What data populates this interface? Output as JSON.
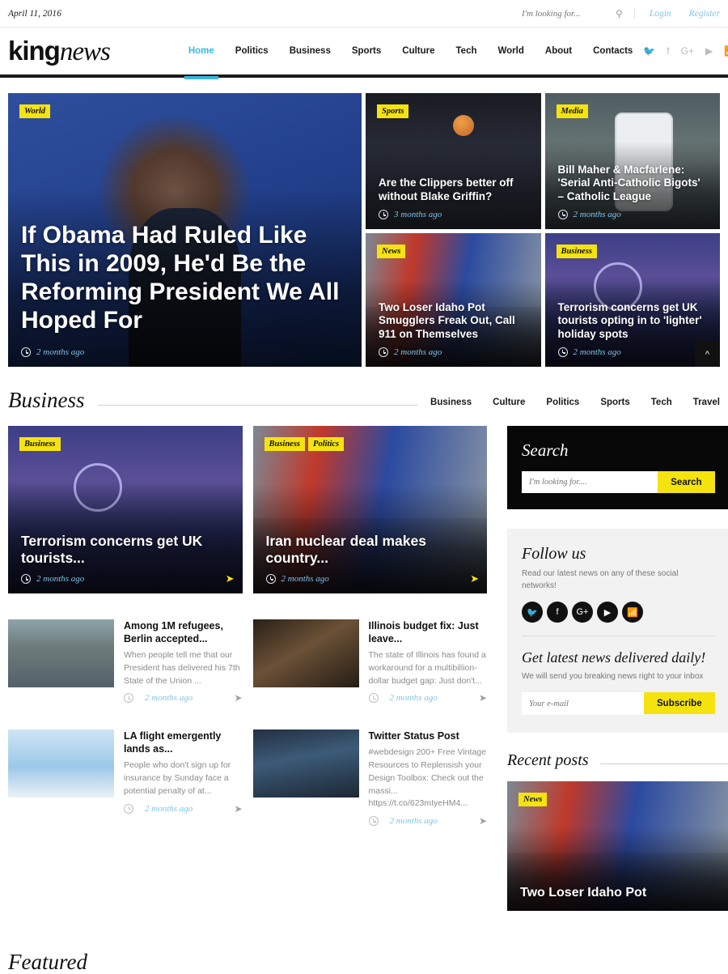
{
  "topbar": {
    "date": "April 11, 2016",
    "search_placeholder": "I'm looking for...",
    "search_value": "",
    "search_icon": "search-icon",
    "login": "Login",
    "register": "Register"
  },
  "header": {
    "logo_bold": "king",
    "logo_italic": "news",
    "nav": [
      {
        "label": "Home",
        "active": true
      },
      {
        "label": "Politics",
        "active": false
      },
      {
        "label": "Business",
        "active": false
      },
      {
        "label": "Sports",
        "active": false
      },
      {
        "label": "Culture",
        "active": false
      },
      {
        "label": "Tech",
        "active": false
      },
      {
        "label": "World",
        "active": false
      },
      {
        "label": "About",
        "active": false
      },
      {
        "label": "Contacts",
        "active": false
      }
    ],
    "social": [
      "twitter-icon",
      "facebook-icon",
      "google-plus-icon",
      "youtube-icon",
      "rss-icon"
    ],
    "accent_color": "#3bb9e0"
  },
  "hero": {
    "main": {
      "badges": [
        "World"
      ],
      "title": "If Obama Had Ruled Like This in 2009, He'd Be the Reforming President We All Hoped For",
      "time": "2 months ago"
    },
    "cards": [
      {
        "badges": [
          "Sports"
        ],
        "title": "Are the Clippers better off without Blake Griffin?",
        "time": "3 months ago"
      },
      {
        "badges": [
          "Media"
        ],
        "title": "Bill Maher & Macfarlene: 'Serial Anti-Catholic Bigots' – Catholic League",
        "time": "2 months ago"
      },
      {
        "badges": [
          "News"
        ],
        "title": "Two Loser Idaho Pot Smugglers Freak Out, Call 911 on Themselves",
        "time": "2 months ago"
      },
      {
        "badges": [
          "Business"
        ],
        "title": "Terrorism concerns get UK tourists opting in to 'lighter' holiday spots",
        "time": "2 months ago"
      }
    ],
    "scroll_top_icon": "chevron-up-icon"
  },
  "section": {
    "title": "Business",
    "tabs": [
      "Business",
      "Culture",
      "Politics",
      "Sports",
      "Tech",
      "Travel"
    ]
  },
  "featured": [
    {
      "badges": [
        "Business"
      ],
      "title": "Terrorism concerns get UK tourists...",
      "time": "2 months ago",
      "share_icon": "share-icon"
    },
    {
      "badges": [
        "Business",
        "Politics"
      ],
      "title": "Iran nuclear deal makes country...",
      "time": "2 months ago",
      "share_icon": "share-icon"
    }
  ],
  "list": [
    {
      "title": "Among 1M refugees, Berlin accepted...",
      "excerpt": "When people tell me that our President has delivered his 7th State of the Union ...",
      "time": "2 months ago",
      "share_icon": "share-icon"
    },
    {
      "title": "Illinois budget fix: Just leave...",
      "excerpt": "The state of Illinois has found a workaround for a multibillion-dollar budget gap: Just don't...",
      "time": "2 months ago",
      "share_icon": "share-icon"
    },
    {
      "title": "LA flight emergently lands as...",
      "excerpt": "People who don't sign up for insurance by Sunday face a potential penalty of at...",
      "time": "2 months ago",
      "share_icon": "share-icon"
    },
    {
      "title": "Twitter Status Post",
      "excerpt": "#webdesign 200+ Free Vintage Resources to Replensish your Design Toolbox: Check out the massi... https://t.co/623mIyeHM4...",
      "time": "2 months ago",
      "share_icon": "share-icon"
    }
  ],
  "sidebar": {
    "search": {
      "title": "Search",
      "placeholder": "I'm looking for....",
      "value": "",
      "button": "Search"
    },
    "follow": {
      "title": "Follow us",
      "subtitle": "Read our latest news on any of these social networks!",
      "socials": [
        "twitter-icon",
        "facebook-icon",
        "google-plus-icon",
        "youtube-icon",
        "rss-icon"
      ],
      "newsletter_title": "Get latest news delivered daily!",
      "newsletter_subtitle": "We will send you breaking news right to your inbox",
      "email_placeholder": "Your e-mail",
      "email_value": "",
      "subscribe_button": "Subscribe"
    },
    "recent": {
      "title": "Recent posts",
      "post": {
        "badges": [
          "News"
        ],
        "title": "Two Loser Idaho Pot"
      }
    }
  },
  "bottom": {
    "featured_peek": "Featured"
  },
  "colors": {
    "accent": "#3bb9e0",
    "badge": "#f5e310",
    "link": "#7fc4e8",
    "dark": "#080808"
  }
}
